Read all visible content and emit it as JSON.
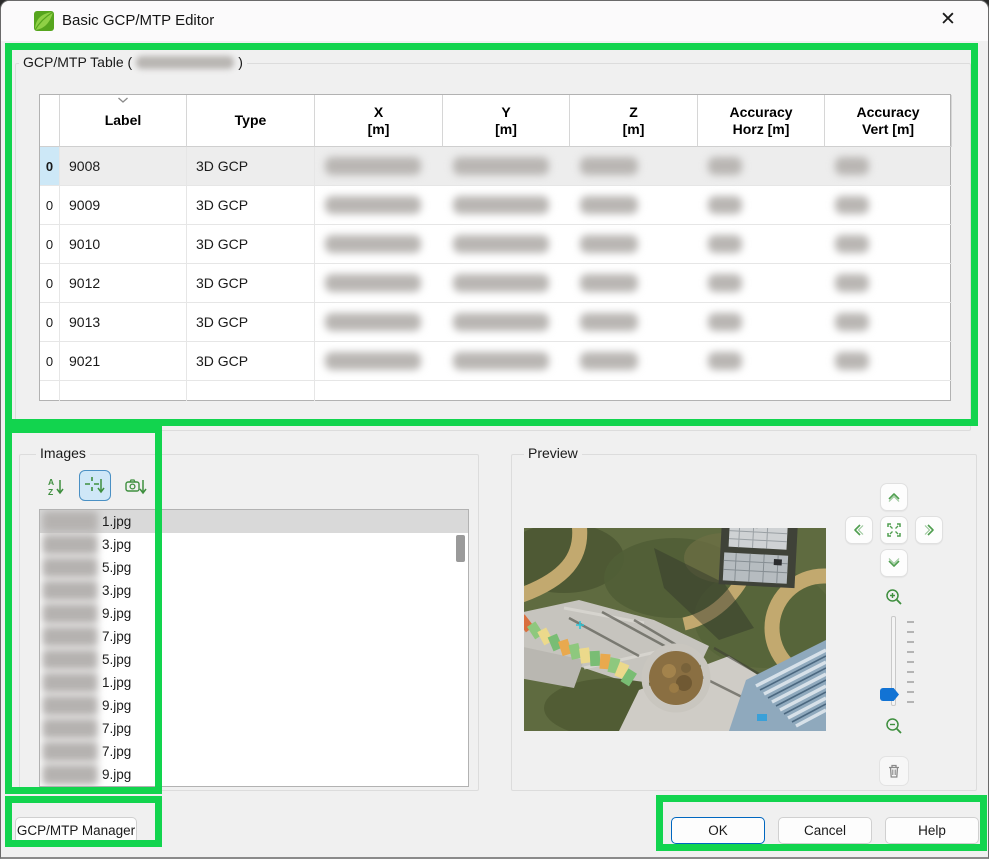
{
  "window": {
    "title": "Basic GCP/MTP Editor",
    "close_glyph": "✕"
  },
  "table_section": {
    "label_prefix": "GCP/MTP Table (",
    "label_suffix": ")",
    "columns": [
      {
        "l1": "",
        "l2": ""
      },
      {
        "l1": "Label",
        "l2": ""
      },
      {
        "l1": "Type",
        "l2": ""
      },
      {
        "l1": "X",
        "l2": "[m]"
      },
      {
        "l1": "Y",
        "l2": "[m]"
      },
      {
        "l1": "Z",
        "l2": "[m]"
      },
      {
        "l1": "Accuracy",
        "l2": "Horz [m]"
      },
      {
        "l1": "Accuracy",
        "l2": "Vert [m]"
      }
    ],
    "rows": [
      {
        "num": "0",
        "label": "9008",
        "type": "3D GCP"
      },
      {
        "num": "0",
        "label": "9009",
        "type": "3D GCP"
      },
      {
        "num": "0",
        "label": "9010",
        "type": "3D GCP"
      },
      {
        "num": "0",
        "label": "9012",
        "type": "3D GCP"
      },
      {
        "num": "0",
        "label": "9013",
        "type": "3D GCP"
      },
      {
        "num": "0",
        "label": "9021",
        "type": "3D GCP"
      }
    ]
  },
  "images_section": {
    "label": "Images",
    "toolbar": [
      {
        "name": "sort-alphabetical"
      },
      {
        "name": "sort-by-marks",
        "selected": true
      },
      {
        "name": "sort-by-camera"
      }
    ],
    "files": [
      "1.jpg",
      "3.jpg",
      "5.jpg",
      "3.jpg",
      "9.jpg",
      "7.jpg",
      "5.jpg",
      "1.jpg",
      "9.jpg",
      "7.jpg",
      "7.jpg",
      "9.jpg"
    ]
  },
  "preview_section": {
    "label": "Preview"
  },
  "footer": {
    "manager": "GCP/MTP Manager",
    "ok": "OK",
    "cancel": "Cancel",
    "help": "Help"
  },
  "colors": {
    "annotation_green": "#12d44e",
    "default_button_border": "#0067c0",
    "toolbar_selected_bg": "#cfe7f7",
    "selected_row_num_bg": "#cde8f7",
    "icon_green": "#4f9e4f"
  }
}
